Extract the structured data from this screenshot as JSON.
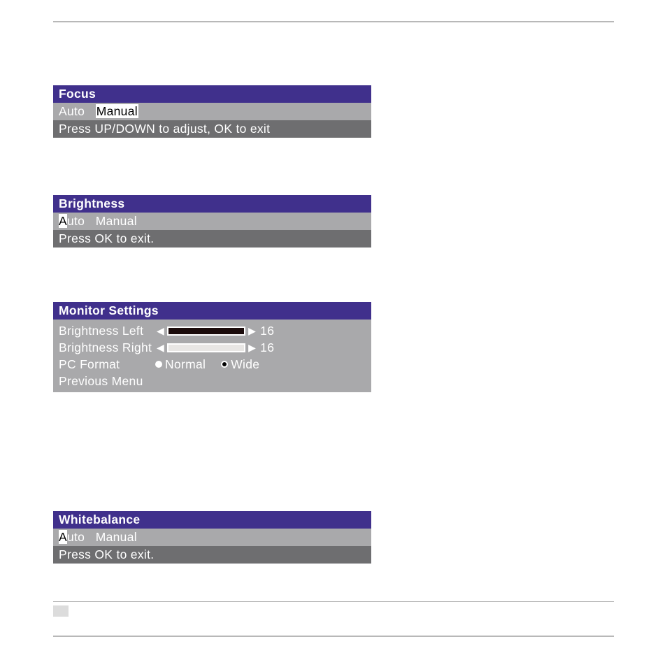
{
  "focus": {
    "title": "Focus",
    "opt_auto": "Auto",
    "opt_manual": "Manual",
    "hint": "Press UP/DOWN to adjust, OK to exit"
  },
  "brightness": {
    "title": "Brightness",
    "firstchar": "A",
    "rest_auto": "uto",
    "opt_manual": "Manual",
    "hint": "Press OK to exit."
  },
  "monitor": {
    "title": "Monitor Settings",
    "row_bl_label": "Brightness Left",
    "row_bl_value": "16",
    "row_br_label": "Brightness Right",
    "row_br_value": "16",
    "row_pc_label": "PC Format",
    "opt_normal": "Normal",
    "opt_wide": "Wide",
    "row_prev": "Previous Menu"
  },
  "wb": {
    "title": "Whitebalance",
    "firstchar": "A",
    "rest_auto": "uto",
    "opt_manual": "Manual",
    "hint": "Press OK to exit."
  }
}
